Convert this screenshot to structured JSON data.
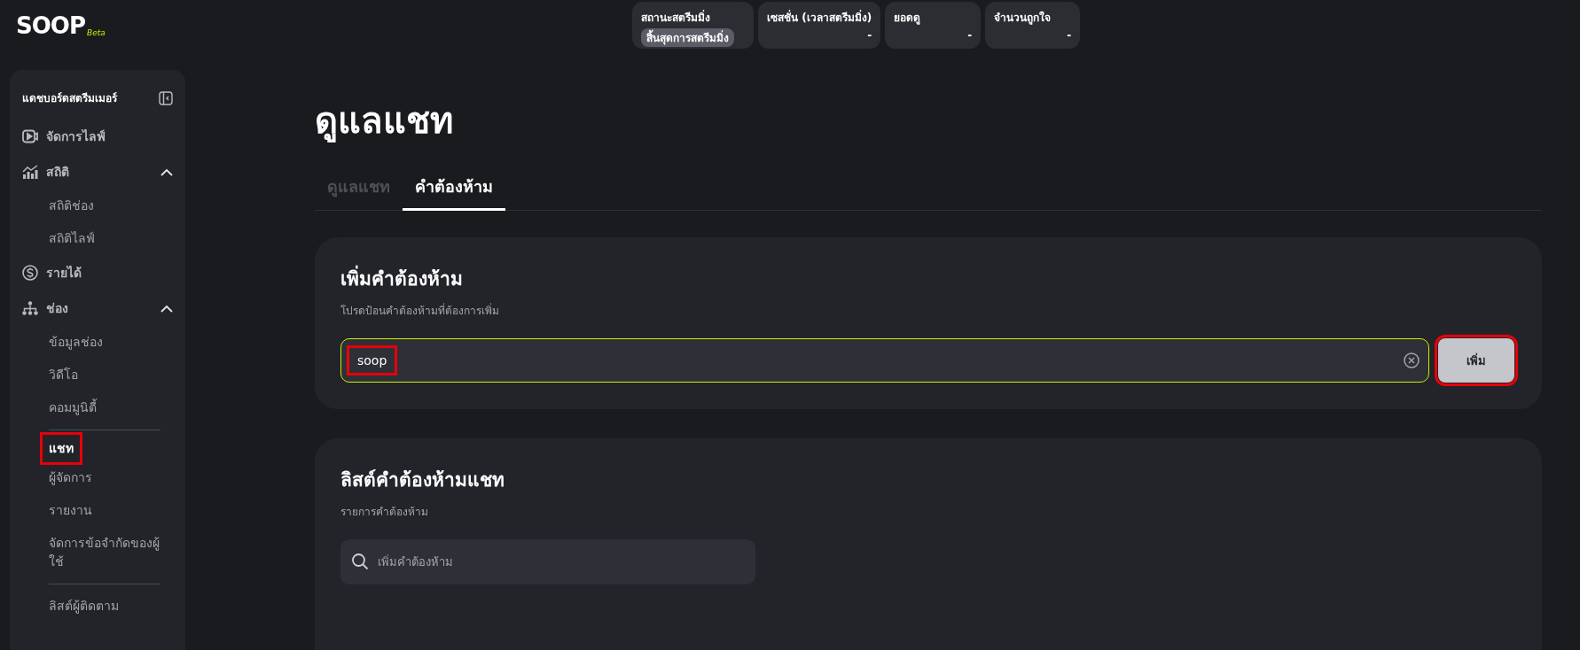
{
  "logo": {
    "name": "SOOP",
    "tag": "Beta"
  },
  "stats": [
    {
      "label": "สถานะสตรีมมิ่ง",
      "value": "สิ้นสุดการสตรีมมิ่ง",
      "kind": "badge"
    },
    {
      "label": "เซสชั่น (เวลาสตรีมมิ่ง)",
      "value": "-",
      "kind": "text"
    },
    {
      "label": "ยอดดู",
      "value": "-",
      "kind": "text"
    },
    {
      "label": "จำนวนถูกใจ",
      "value": "-",
      "kind": "text"
    }
  ],
  "sidebar": {
    "title": "แดชบอร์ดสตรีมเมอร์",
    "items": [
      {
        "label": "จัดการไลฟ์",
        "kind": "link"
      },
      {
        "label": "สถิติ",
        "kind": "group",
        "expanded": true,
        "children": [
          {
            "label": "สถิติช่อง",
            "kind": "link",
            "selected": false,
            "highlighted": false
          },
          {
            "label": "สถิติไลฟ์",
            "kind": "link",
            "selected": false,
            "highlighted": false
          }
        ]
      },
      {
        "label": "รายได้",
        "kind": "link"
      },
      {
        "label": "ช่อง",
        "kind": "group",
        "expanded": true,
        "children": [
          {
            "label": "ข้อมูลช่อง",
            "kind": "link",
            "selected": false,
            "highlighted": false
          },
          {
            "label": "วิดีโอ",
            "kind": "link",
            "selected": false,
            "highlighted": false
          },
          {
            "label": "คอมมูนิตี้",
            "kind": "link",
            "selected": false,
            "highlighted": false
          },
          {
            "kind": "divider"
          },
          {
            "label": "แชท",
            "kind": "link",
            "selected": true,
            "highlighted": true
          },
          {
            "label": "ผู้จัดการ",
            "kind": "link",
            "selected": false,
            "highlighted": false
          },
          {
            "label": "รายงาน",
            "kind": "link",
            "selected": false,
            "highlighted": false
          },
          {
            "label": "จัดการข้อจำกัดของผู้ใช้",
            "kind": "link",
            "selected": false,
            "highlighted": false
          },
          {
            "kind": "divider"
          },
          {
            "label": "ลิสต์ผู้ติดตาม",
            "kind": "link",
            "selected": false,
            "highlighted": false
          }
        ]
      }
    ]
  },
  "page": {
    "title": "ดูแลแชท",
    "tabs": [
      {
        "label": "ดูแลแชท",
        "selected": false
      },
      {
        "label": "คำต้องห้าม",
        "selected": true
      }
    ],
    "add_card": {
      "title": "เพิ่มคำต้องห้าม",
      "subtitle": "โปรดป้อนคำต้องห้ามที่ต้องการเพิ่ม",
      "input": {
        "value": "soop",
        "highlighted": true
      },
      "button": {
        "label": "เพิ่ม",
        "highlighted": true
      }
    },
    "list_card": {
      "title": "ลิสต์คำต้องห้ามแชท",
      "subtitle": "รายการคำต้องห้าม",
      "search": {
        "placeholder": "เพิ่มคำต้องห้าม"
      }
    }
  }
}
